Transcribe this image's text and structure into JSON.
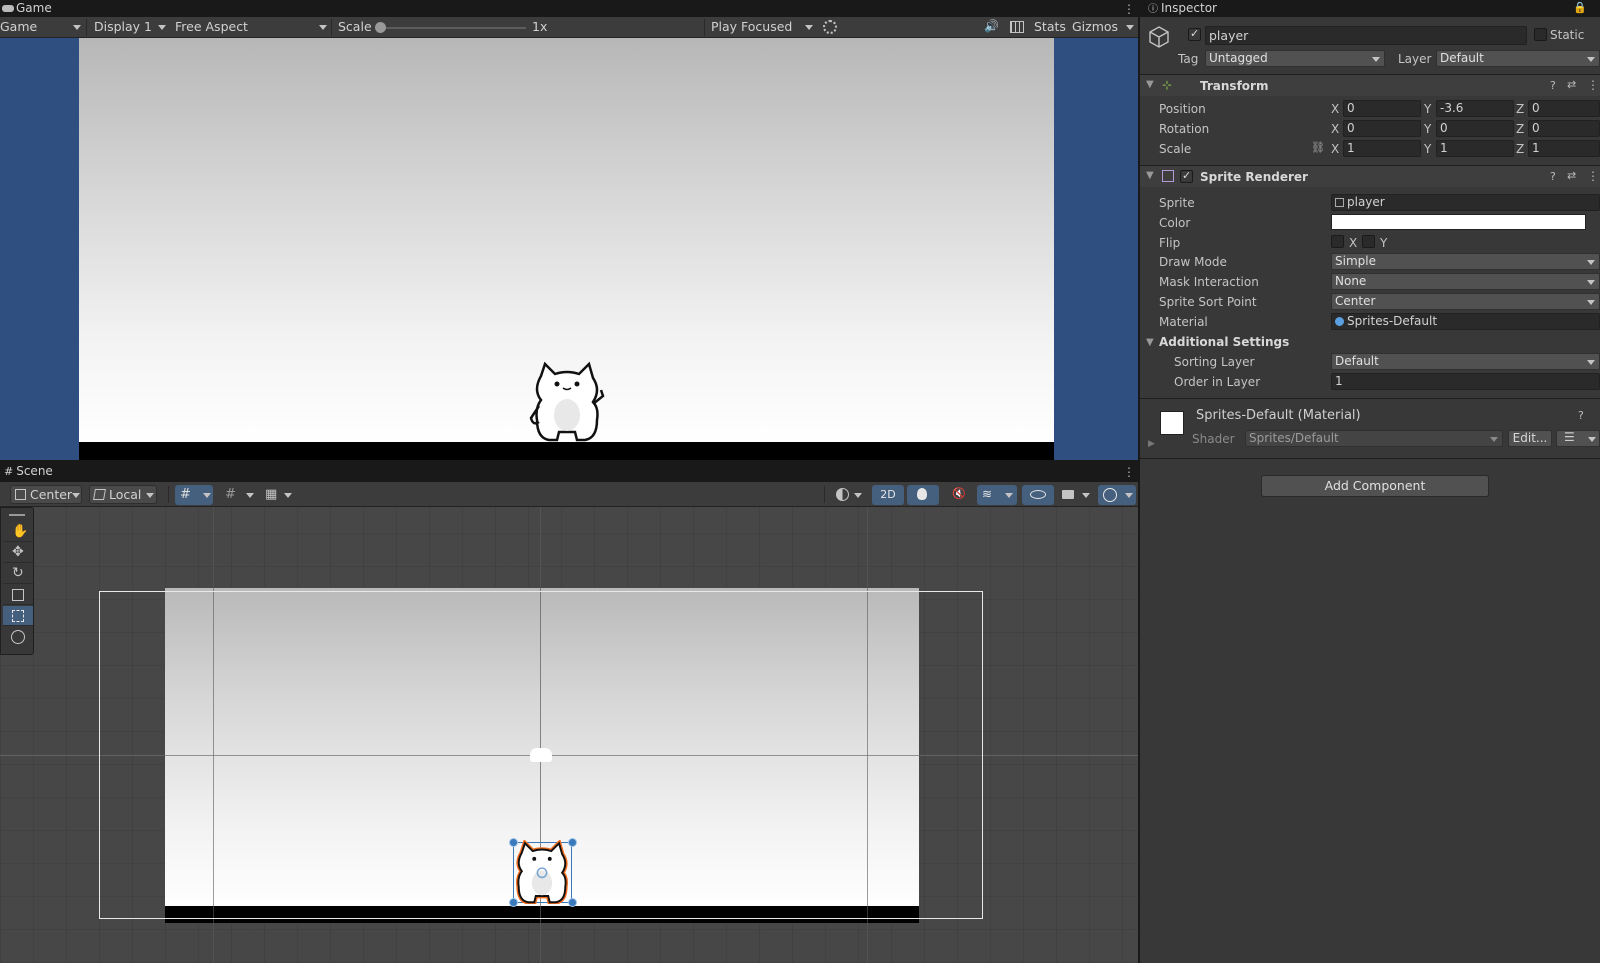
{
  "game": {
    "tab_title": "Game",
    "mode": "Game",
    "display": "Display 1",
    "aspect": "Free Aspect",
    "scale_label": "Scale",
    "scale_value": "1x",
    "play_mode": "Play Focused",
    "stats": "Stats",
    "gizmos": "Gizmos"
  },
  "scene": {
    "tab_title": "Scene",
    "pivot": "Center",
    "space": "Local",
    "mode_2d": "2D"
  },
  "inspector": {
    "tab_title": "Inspector",
    "object_name": "player",
    "static_label": "Static",
    "tag_label": "Tag",
    "tag_value": "Untagged",
    "layer_label": "Layer",
    "layer_value": "Default",
    "transform": {
      "title": "Transform",
      "rows": [
        {
          "label": "Position",
          "x": "0",
          "y": "-3.6",
          "z": "0"
        },
        {
          "label": "Rotation",
          "x": "0",
          "y": "0",
          "z": "0"
        },
        {
          "label": "Scale",
          "x": "1",
          "y": "1",
          "z": "1"
        }
      ],
      "axis_x": "X",
      "axis_y": "Y",
      "axis_z": "Z"
    },
    "sprite_renderer": {
      "title": "Sprite Renderer",
      "sprite_label": "Sprite",
      "sprite_value": "player",
      "color_label": "Color",
      "flip_label": "Flip",
      "flip_x": "X",
      "flip_y": "Y",
      "draw_mode_label": "Draw Mode",
      "draw_mode_value": "Simple",
      "mask_label": "Mask Interaction",
      "mask_value": "None",
      "sort_point_label": "Sprite Sort Point",
      "sort_point_value": "Center",
      "material_label": "Material",
      "material_value": "Sprites-Default",
      "additional_label": "Additional Settings",
      "sorting_layer_label": "Sorting Layer",
      "sorting_layer_value": "Default",
      "order_label": "Order in Layer",
      "order_value": "1"
    },
    "material": {
      "title": "Sprites-Default (Material)",
      "shader_label": "Shader",
      "shader_value": "Sprites/Default",
      "edit_label": "Edit..."
    },
    "add_component": "Add Component"
  },
  "colors": {
    "accent": "#3a79bb",
    "selection_outline": "#f26b1d",
    "game_bg": "#2e4f80"
  }
}
